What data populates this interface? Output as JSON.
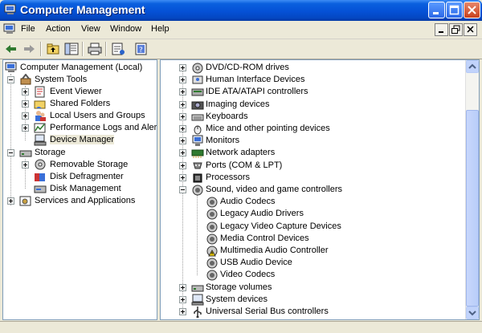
{
  "window": {
    "title": "Computer Management"
  },
  "menubar": {
    "items": [
      "File",
      "Action",
      "View",
      "Window",
      "Help"
    ]
  },
  "toolbar": {
    "buttons": [
      "back-arrow-icon",
      "forward-arrow-icon",
      "up-level-icon",
      "show-hide-tree-icon",
      "print-icon",
      "properties-icon",
      "help-icon"
    ]
  },
  "left_tree": {
    "items": [
      {
        "label": "Computer Management (Local)",
        "icon": "computer-management-icon"
      },
      {
        "label": "System Tools",
        "icon": "system-tools-icon"
      },
      {
        "label": "Event Viewer",
        "icon": "event-viewer-icon"
      },
      {
        "label": "Shared Folders",
        "icon": "shared-folders-icon"
      },
      {
        "label": "Local Users and Groups",
        "icon": "users-groups-icon"
      },
      {
        "label": "Performance Logs and Alerts",
        "icon": "performance-logs-icon"
      },
      {
        "label": "Device Manager",
        "icon": "device-manager-icon",
        "selected": true
      },
      {
        "label": "Storage",
        "icon": "storage-icon"
      },
      {
        "label": "Removable Storage",
        "icon": "removable-storage-icon"
      },
      {
        "label": "Disk Defragmenter",
        "icon": "disk-defragmenter-icon"
      },
      {
        "label": "Disk Management",
        "icon": "disk-management-icon"
      },
      {
        "label": "Services and Applications",
        "icon": "services-applications-icon"
      }
    ]
  },
  "device_tree": {
    "items": [
      {
        "label": "DVD/CD-ROM drives",
        "icon": "cdrom-icon"
      },
      {
        "label": "Human Interface Devices",
        "icon": "hid-icon"
      },
      {
        "label": "IDE ATA/ATAPI controllers",
        "icon": "ide-controller-icon"
      },
      {
        "label": "Imaging devices",
        "icon": "camera-icon"
      },
      {
        "label": "Keyboards",
        "icon": "keyboard-icon"
      },
      {
        "label": "Mice and other pointing devices",
        "icon": "mouse-icon"
      },
      {
        "label": "Monitors",
        "icon": "monitor-icon"
      },
      {
        "label": "Network adapters",
        "icon": "network-adapter-icon"
      },
      {
        "label": "Ports (COM & LPT)",
        "icon": "port-icon"
      },
      {
        "label": "Processors",
        "icon": "processor-icon"
      },
      {
        "label": "Sound, video and game controllers",
        "icon": "sound-icon"
      },
      {
        "label": "Audio Codecs",
        "icon": "sound-device-icon"
      },
      {
        "label": "Legacy Audio Drivers",
        "icon": "sound-device-icon"
      },
      {
        "label": "Legacy Video Capture Devices",
        "icon": "sound-device-icon"
      },
      {
        "label": "Media Control Devices",
        "icon": "sound-device-icon"
      },
      {
        "label": "Multimedia Audio Controller",
        "icon": "warning-device-icon"
      },
      {
        "label": "USB Audio Device",
        "icon": "sound-device-icon"
      },
      {
        "label": "Video Codecs",
        "icon": "sound-device-icon"
      },
      {
        "label": "Storage volumes",
        "icon": "storage-volume-icon"
      },
      {
        "label": "System devices",
        "icon": "system-device-icon"
      },
      {
        "label": "Universal Serial Bus controllers",
        "icon": "usb-icon"
      }
    ]
  }
}
